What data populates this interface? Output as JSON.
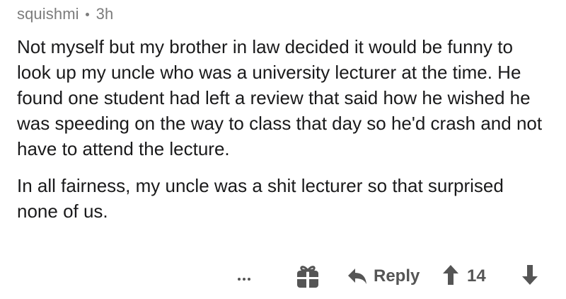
{
  "comment": {
    "author": "squishmi",
    "age": "3h",
    "paragraphs": [
      "Not myself but my brother in law decided it would be funny to look up my uncle who was a university lecturer at the time. He found one student had left a review that said how he wished he was speeding on the way to class that day so he'd crash and not have to attend the lecture.",
      "In all fairness, my uncle was a shit lecturer so that surprised none of us."
    ]
  },
  "actions": {
    "more_icon": "more-dots-icon",
    "gift_icon": "gift-icon",
    "reply_icon": "reply-arrow-icon",
    "reply_label": "Reply",
    "upvote_icon": "upvote-arrow-icon",
    "score": "14",
    "downvote_icon": "downvote-arrow-icon"
  },
  "colors": {
    "meta_text": "#7c7c7c",
    "body_text": "#1a1a1b",
    "action_gray": "#555555"
  }
}
